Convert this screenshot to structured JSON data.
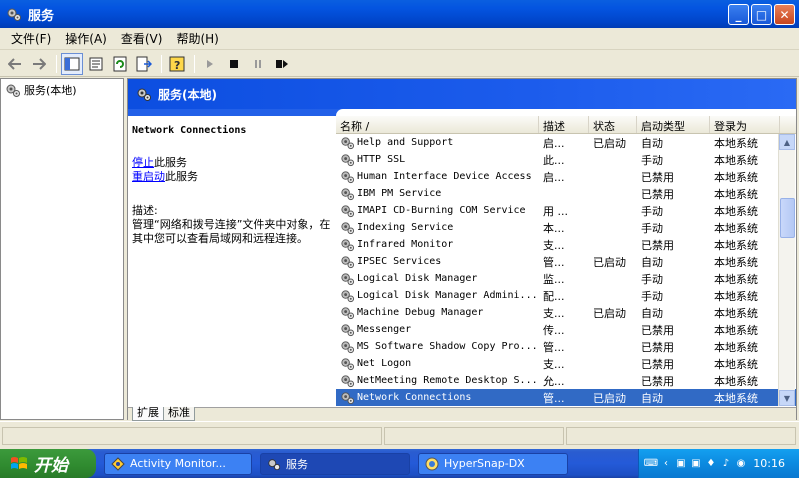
{
  "window": {
    "title": "服务",
    "controls": {
      "minimize": "_",
      "maximize": "□",
      "close": "✕"
    }
  },
  "menubar": [
    "文件(F)",
    "操作(A)",
    "查看(V)",
    "帮助(H)"
  ],
  "toolbar": [
    {
      "icon": "back-arrow-icon"
    },
    {
      "icon": "forward-arrow-icon"
    },
    {
      "icon": "show-hide-tree-icon"
    },
    {
      "icon": "properties-icon"
    },
    {
      "icon": "refresh-icon"
    },
    {
      "icon": "export-list-icon"
    },
    {
      "icon": "help-icon"
    },
    {
      "icon": "play-icon"
    },
    {
      "icon": "stop-icon"
    },
    {
      "icon": "pause-icon"
    },
    {
      "icon": "restart-icon"
    }
  ],
  "tree": {
    "root_label": "服务(本地)"
  },
  "banner": {
    "title": "服务(本地)"
  },
  "description": {
    "service_name": "Network Connections",
    "stop_link": "停止",
    "stop_suffix": "此服务",
    "restart_link": "重启动",
    "restart_suffix": "此服务",
    "label": "描述:",
    "text": "管理“网络和拨号连接”文件夹中对象，在其中您可以查看局域网和远程连接。"
  },
  "list": {
    "columns": [
      "名称 /",
      "描述",
      "状态",
      "启动类型",
      "登录为"
    ],
    "rows": [
      {
        "name": "Help and Support",
        "desc": "启...",
        "status": "已启动",
        "startup": "自动",
        "logon": "本地系统"
      },
      {
        "name": "HTTP SSL",
        "desc": "此...",
        "status": "",
        "startup": "手动",
        "logon": "本地系统"
      },
      {
        "name": "Human Interface Device Access",
        "desc": "启...",
        "status": "",
        "startup": "已禁用",
        "logon": "本地系统"
      },
      {
        "name": "IBM PM Service",
        "desc": "",
        "status": "",
        "startup": "已禁用",
        "logon": "本地系统"
      },
      {
        "name": "IMAPI CD-Burning COM Service",
        "desc": "用 ...",
        "status": "",
        "startup": "手动",
        "logon": "本地系统"
      },
      {
        "name": "Indexing Service",
        "desc": "本...",
        "status": "",
        "startup": "手动",
        "logon": "本地系统"
      },
      {
        "name": "Infrared Monitor",
        "desc": "支...",
        "status": "",
        "startup": "已禁用",
        "logon": "本地系统"
      },
      {
        "name": "IPSEC Services",
        "desc": "管...",
        "status": "已启动",
        "startup": "自动",
        "logon": "本地系统"
      },
      {
        "name": "Logical Disk Manager",
        "desc": "监...",
        "status": "",
        "startup": "手动",
        "logon": "本地系统"
      },
      {
        "name": "Logical Disk Manager Admini...",
        "desc": "配...",
        "status": "",
        "startup": "手动",
        "logon": "本地系统"
      },
      {
        "name": "Machine Debug Manager",
        "desc": "支...",
        "status": "已启动",
        "startup": "自动",
        "logon": "本地系统"
      },
      {
        "name": "Messenger",
        "desc": "传...",
        "status": "",
        "startup": "已禁用",
        "logon": "本地系统"
      },
      {
        "name": "MS Software Shadow Copy Pro...",
        "desc": "管...",
        "status": "",
        "startup": "已禁用",
        "logon": "本地系统"
      },
      {
        "name": "Net Logon",
        "desc": "支...",
        "status": "",
        "startup": "已禁用",
        "logon": "本地系统"
      },
      {
        "name": "NetMeeting Remote Desktop S...",
        "desc": "允...",
        "status": "",
        "startup": "已禁用",
        "logon": "本地系统"
      },
      {
        "name": "Network Connections",
        "desc": "管...",
        "status": "已启动",
        "startup": "自动",
        "logon": "本地系统",
        "selected": true
      }
    ]
  },
  "tabs": [
    "扩展",
    "标准"
  ],
  "taskbar": {
    "start_label": "开始",
    "tasks": [
      {
        "label": "Activity Monitor...",
        "icon": "activity-monitor-icon"
      },
      {
        "label": "服务",
        "icon": "services-gear-icon",
        "active": true
      },
      {
        "label": "HyperSnap-DX",
        "icon": "hypersnap-icon"
      }
    ],
    "clock": "10:16"
  }
}
